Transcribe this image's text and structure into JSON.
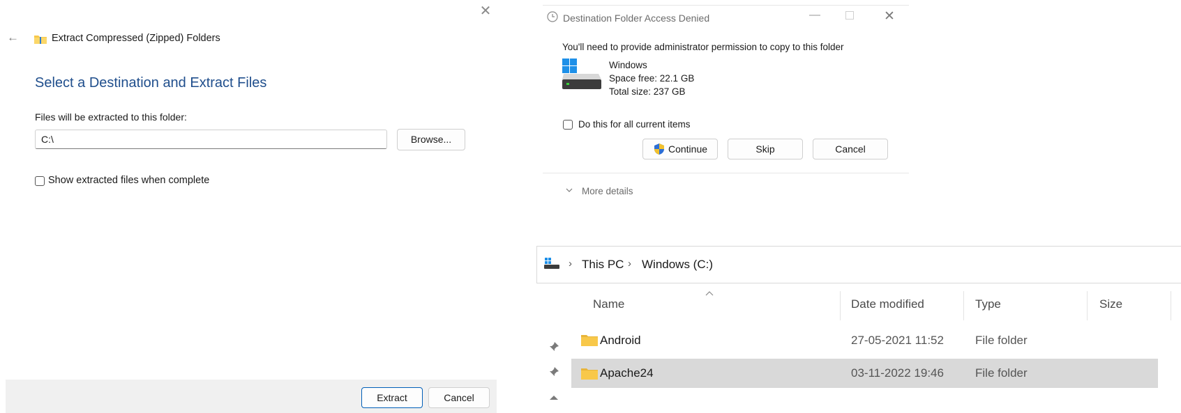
{
  "wizard": {
    "title": "Extract Compressed (Zipped) Folders",
    "heading": "Select a Destination and Extract Files",
    "folder_label": "Files will be extracted to this folder:",
    "path_value": "C:\\",
    "browse_label": "Browse...",
    "show_files_label": "Show extracted files when complete",
    "show_files_checked": false,
    "extract_label": "Extract",
    "cancel_label": "Cancel",
    "icons": {
      "back": "back-arrow-icon",
      "close": "close-icon",
      "app": "zip-folder-icon"
    }
  },
  "denied_dialog": {
    "title": "Destination Folder Access Denied",
    "message": "You'll need to provide administrator permission to copy to this folder",
    "drive": {
      "name": "Windows",
      "free": "Space free: 22.1 GB",
      "total": "Total size: 237 GB"
    },
    "apply_all_label": "Do this for all current items",
    "apply_all_checked": false,
    "continue_label": "Continue",
    "skip_label": "Skip",
    "cancel_label": "Cancel",
    "more_details_label": "More details",
    "icons": {
      "title": "clock-icon",
      "drive": "windows-drive-icon",
      "continue": "uac-shield-icon"
    }
  },
  "explorer": {
    "breadcrumb": [
      "This PC",
      "Windows (C:)"
    ],
    "columns": {
      "name": "Name",
      "date": "Date modified",
      "type": "Type",
      "size": "Size"
    },
    "rows": [
      {
        "name": "Android",
        "date": "27-05-2021 11:52",
        "type": "File folder",
        "selected": false
      },
      {
        "name": "Apache24",
        "date": "03-11-2022 19:46",
        "type": "File folder",
        "selected": true
      }
    ]
  },
  "colors": {
    "heading_blue": "#1f4e8c",
    "accent_blue": "#005fb8",
    "footer_gray": "#f0f0f0",
    "selected_row": "#d9d9d9",
    "folder_yellow": "#f8c84a"
  }
}
